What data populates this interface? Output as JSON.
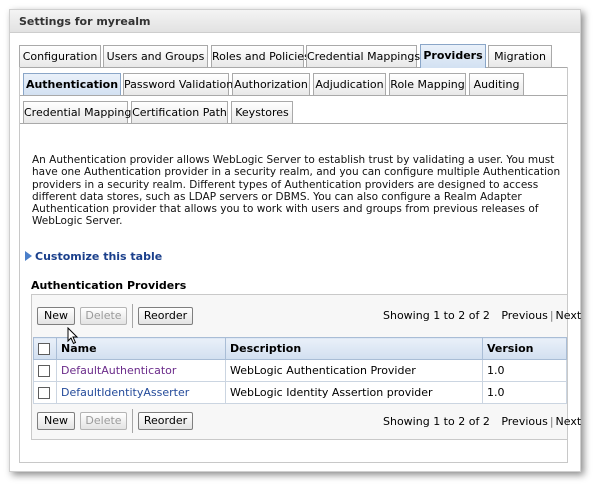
{
  "window_title": "Settings for myrealm",
  "main_tabs": [
    "Configuration",
    "Users and Groups",
    "Roles and Policies",
    "Credential Mappings",
    "Providers",
    "Migration"
  ],
  "sub_tabs_row1": [
    "Authentication",
    "Password Validation",
    "Authorization",
    "Adjudication",
    "Role Mapping",
    "Auditing"
  ],
  "sub_tabs_row2": [
    "Credential Mapping",
    "Certification Path",
    "Keystores"
  ],
  "description": "An Authentication provider allows WebLogic Server to establish trust by validating a user. You must have one Authentication provider in a security realm, and you can configure multiple Authentication providers in a security realm. Different types of Authentication providers are designed to access different data stores, such as LDAP servers or DBMS. You can also configure a Realm Adapter Authentication provider that allows you to work with users and groups from previous releases of WebLogic Server.",
  "customize_link": "Customize this table",
  "section_title": "Authentication Providers",
  "toolbar": {
    "new": "New",
    "delete": "Delete",
    "reorder": "Reorder"
  },
  "paging": {
    "showing": "Showing 1 to 2 of 2",
    "previous": "Previous",
    "next": "Next"
  },
  "table": {
    "headers": [
      "Name",
      "Description",
      "Version"
    ],
    "rows": [
      {
        "name": "DefaultAuthenticator",
        "description": "WebLogic Authentication Provider",
        "version": "1.0"
      },
      {
        "name": "DefaultIdentityAsserter",
        "description": "WebLogic Identity Assertion provider",
        "version": "1.0"
      }
    ]
  },
  "active_main_tab": "Providers",
  "active_sub_tab": "Authentication"
}
